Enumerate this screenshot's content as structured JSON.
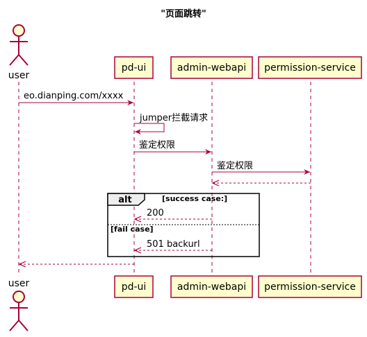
{
  "diagram": {
    "title": "\"页面跳转\"",
    "colors": {
      "line": "#A80036",
      "box_fill": "#FEFECE",
      "frame": "#000000",
      "background": "#FFFFFF"
    },
    "participants": [
      {
        "id": "user",
        "label": "user",
        "kind": "actor"
      },
      {
        "id": "pd_ui",
        "label": "pd-ui",
        "kind": "participant"
      },
      {
        "id": "admin_webapi",
        "label": "admin-webapi",
        "kind": "participant"
      },
      {
        "id": "permission_service",
        "label": "permission-service",
        "kind": "participant"
      }
    ],
    "messages": [
      {
        "from": "user",
        "to": "pd_ui",
        "label": "eo.dianping.com/xxxx",
        "style": "solid"
      },
      {
        "from": "pd_ui",
        "to": "pd_ui",
        "label": "jumper拦截请求",
        "style": "solid"
      },
      {
        "from": "pd_ui",
        "to": "admin_webapi",
        "label": "鉴定权限",
        "style": "solid"
      },
      {
        "from": "admin_webapi",
        "to": "permission_service",
        "label": "鉴定权限",
        "style": "solid"
      },
      {
        "from": "permission_service",
        "to": "admin_webapi",
        "label": "",
        "style": "dashed"
      },
      {
        "from": "admin_webapi",
        "to": "pd_ui",
        "label": "200",
        "style": "dashed"
      },
      {
        "from": "admin_webapi",
        "to": "pd_ui",
        "label": "501 backurl",
        "style": "dashed"
      },
      {
        "from": "pd_ui",
        "to": "user",
        "label": "",
        "style": "dashed"
      }
    ],
    "fragment": {
      "operator": "alt",
      "branches": [
        "[success case:]",
        "[fail case]"
      ]
    }
  }
}
